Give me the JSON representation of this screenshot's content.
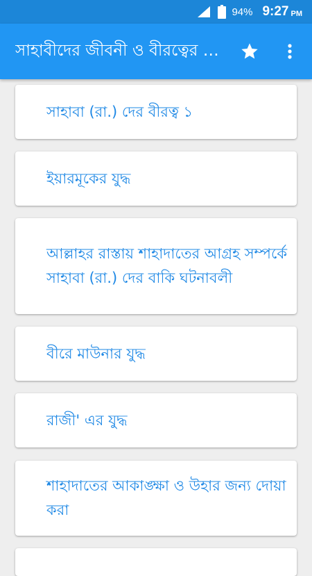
{
  "status_bar": {
    "battery_percent": "94%",
    "time": "9:27",
    "ampm": "PM",
    "icons": [
      "wifi-icon",
      "battery-icon"
    ]
  },
  "app_bar": {
    "title": "সাহাবীদের জীবনী ও বীরত্বের কাহিনী",
    "actions": [
      "star-icon",
      "more-vert-icon"
    ]
  },
  "colors": {
    "status_bar": "#1c86d8",
    "app_bar": "#2196f3",
    "item_text": "#1e88e5",
    "background": "#eeeeee"
  },
  "items": [
    {
      "label": "সাহাবা (রা.) দের বীরত্ব ১"
    },
    {
      "label": "ইয়ারমূকের যুদ্ধ"
    },
    {
      "label": "আল্লাহর রাস্তায় শাহাদাতের আগ্রহ সম্পর্কে সাহাবা (রা.) দের বাকি ঘটনাবলী"
    },
    {
      "label": "বীরে মাউনার যুদ্ধ"
    },
    {
      "label": "রাজী' এর যুদ্ধ"
    },
    {
      "label": "শাহাদাতের আকাঙ্ক্ষা ও উহার জন্য দোয়া করা"
    }
  ]
}
